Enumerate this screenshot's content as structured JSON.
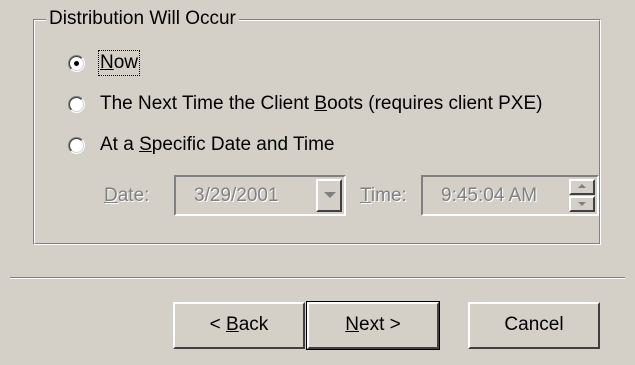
{
  "group": {
    "title": "Distribution Will Occur"
  },
  "options": [
    {
      "pre": "",
      "key": "N",
      "post": "ow",
      "checked": true
    },
    {
      "pre": "The Next Time the Client ",
      "key": "B",
      "post": "oots (requires client PXE)",
      "checked": false
    },
    {
      "pre": "At a ",
      "key": "S",
      "post": "pecific Date and Time",
      "checked": false
    }
  ],
  "date": {
    "label_key": "D",
    "label_rest": "ate:",
    "value": "3/29/2001"
  },
  "time": {
    "label_key": "T",
    "label_rest": "ime:",
    "value": "9:45:04 AM"
  },
  "buttons": {
    "back": {
      "pre": "< ",
      "key": "B",
      "post": "ack"
    },
    "next": {
      "pre": "",
      "key": "N",
      "post": "ext >"
    },
    "cancel": {
      "label": "Cancel"
    }
  }
}
